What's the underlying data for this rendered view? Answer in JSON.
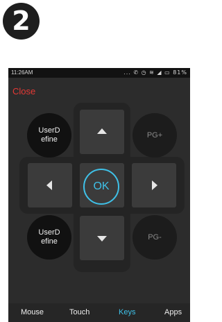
{
  "step_badge": "2",
  "status": {
    "time": "11:26AM",
    "icons": "... ✆ ◷ ≋ ◢ ▭ 81%"
  },
  "close_label": "Close",
  "keys": {
    "user_define_top": "UserD\nefine",
    "pg_up": "PG+",
    "ok": "OK",
    "user_define_bottom": "UserD\nefine",
    "pg_down": "PG-"
  },
  "tabs": [
    {
      "label": "Mouse",
      "active": false
    },
    {
      "label": "Touch",
      "active": false
    },
    {
      "label": "Keys",
      "active": true
    },
    {
      "label": "Apps",
      "active": false
    }
  ],
  "colors": {
    "accent": "#3fc1e8",
    "close": "#e53935"
  }
}
